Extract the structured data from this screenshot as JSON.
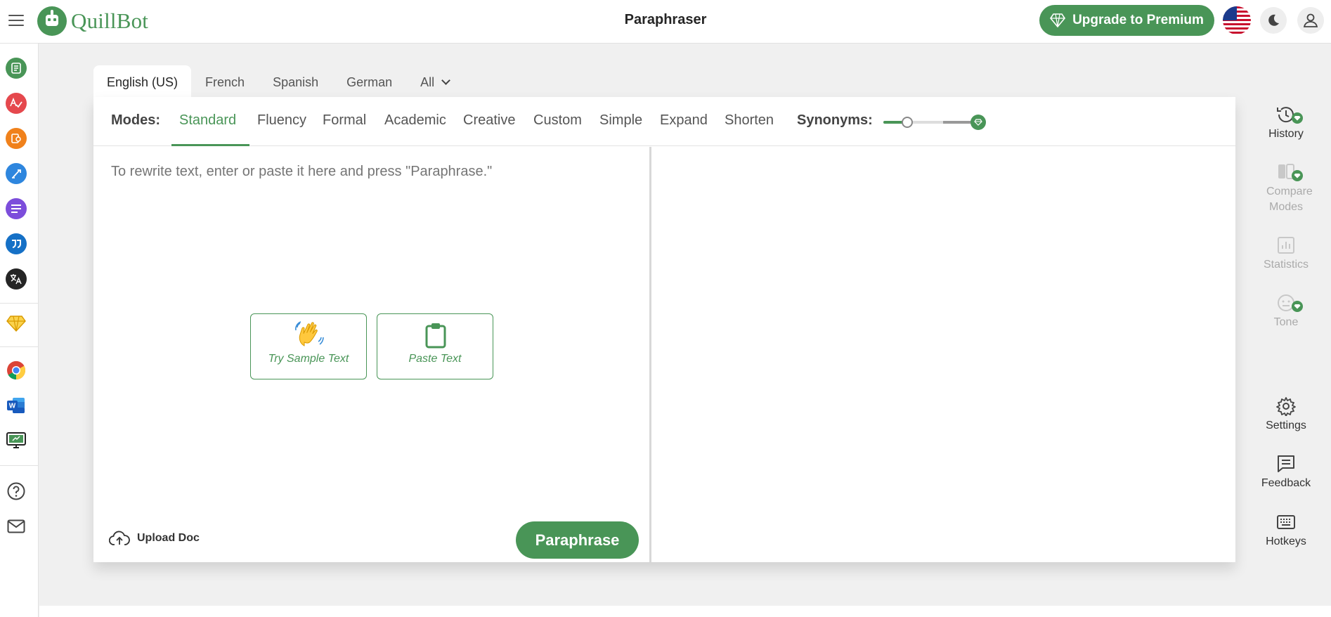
{
  "header": {
    "brand": "QuillBot",
    "title": "Paraphraser",
    "upgrade_label": "Upgrade to Premium"
  },
  "colors": {
    "accent": "#499557",
    "rail_icons": [
      "#499557",
      "#e5484d",
      "#f0811b",
      "#2e86de",
      "#7c4ddb",
      "#1570c6",
      "#252525"
    ],
    "premium_gem": "#f5b400"
  },
  "left_rail": {
    "tools": [
      "paraphraser-icon",
      "grammar-checker-icon",
      "plagiarism-checker-icon",
      "co-writer-icon",
      "summarizer-icon",
      "citation-generator-icon",
      "translator-icon"
    ],
    "premium": "premium-gem-icon",
    "apps": [
      "chrome-extension-icon",
      "word-addin-icon",
      "desktop-app-icon"
    ],
    "support": [
      "help-icon",
      "contact-mail-icon"
    ]
  },
  "languages": [
    {
      "label": "English (US)",
      "active": true
    },
    {
      "label": "French"
    },
    {
      "label": "Spanish"
    },
    {
      "label": "German"
    },
    {
      "label": "All"
    }
  ],
  "modes": {
    "label": "Modes:",
    "items": [
      "Standard",
      "Fluency",
      "Formal",
      "Academic",
      "Creative",
      "Custom",
      "Simple",
      "Expand",
      "Shorten"
    ],
    "active": "Standard"
  },
  "synonyms": {
    "label": "Synonyms:",
    "level": 0.25
  },
  "input": {
    "placeholder": "To rewrite text, enter or paste it here and press \"Paraphrase.\""
  },
  "buttons": {
    "sample": "Try Sample Text",
    "paste": "Paste Text",
    "upload": "Upload Doc",
    "paraphrase": "Paraphrase"
  },
  "right_panel": {
    "history": "History",
    "compare": "Compare Modes",
    "statistics": "Statistics",
    "tone": "Tone",
    "settings": "Settings",
    "feedback": "Feedback",
    "hotkeys": "Hotkeys"
  }
}
